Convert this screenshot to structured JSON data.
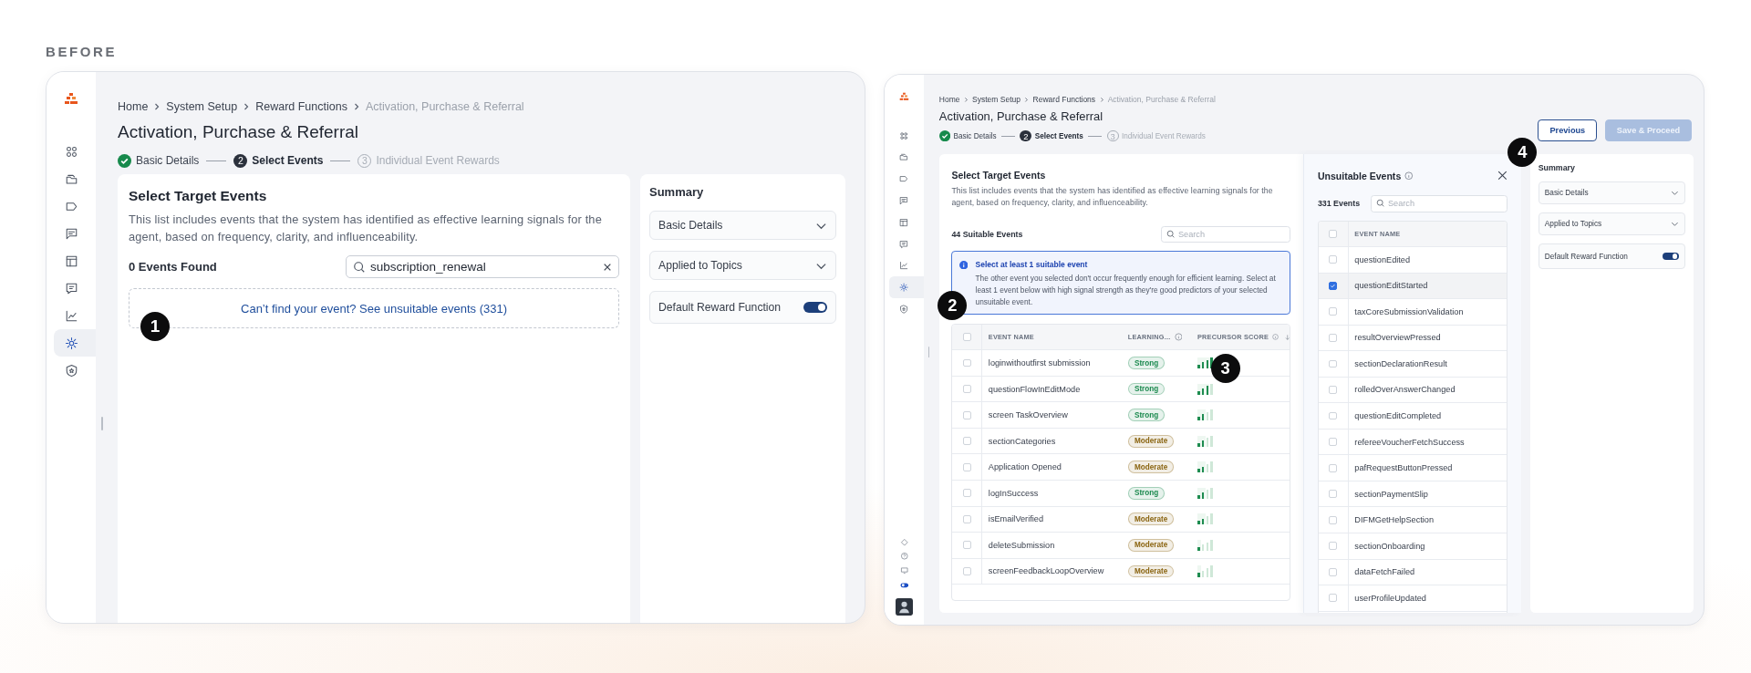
{
  "heading": "BEFORE",
  "screens": [
    {
      "sidebar": {
        "items": [
          {
            "selected": false
          },
          {
            "selected": false
          },
          {
            "selected": false
          },
          {
            "selected": false
          },
          {
            "selected": false
          },
          {
            "selected": false
          },
          {
            "selected": false
          },
          {
            "selected": true
          },
          {
            "selected": false
          }
        ]
      },
      "breadcrumb": [
        "Home",
        "System Setup",
        "Reward Functions",
        "Activation, Purchase & Referral"
      ],
      "title": "Activation, Purchase & Referral",
      "steps": [
        {
          "label": "Basic Details",
          "kind": "done"
        },
        {
          "number": "2",
          "label": "Select Events",
          "kind": "current"
        },
        {
          "number": "3",
          "label": "Individual Event Rewards",
          "kind": "upcoming"
        }
      ],
      "main": {
        "title": "Select Target Events",
        "description": "This list includes events that the system has identified as effective learning signals for the agent, based on frequency, clarity, and influenceability.",
        "count": "0 Events Found",
        "search": {
          "value": "subscription_renewal"
        },
        "empty_link": "Can’t find your event? See unsuitable events (331)"
      },
      "summary": {
        "title": "Summary",
        "items": [
          {
            "kind": "dropdown",
            "label": "Basic Details"
          },
          {
            "kind": "dropdown",
            "label": "Applied to Topics"
          },
          {
            "kind": "toggle",
            "label": "Default Reward Function",
            "on": true
          }
        ]
      },
      "markers": [
        "1"
      ]
    },
    {
      "sidebar": {
        "items": [
          {
            "selected": false
          },
          {
            "selected": false
          },
          {
            "selected": false
          },
          {
            "selected": false
          },
          {
            "selected": false
          },
          {
            "selected": false
          },
          {
            "selected": false
          },
          {
            "selected": true
          },
          {
            "selected": false
          }
        ],
        "utility_icons": true
      },
      "breadcrumb": [
        "Home",
        "System Setup",
        "Reward Functions",
        "Activation, Purchase & Referral"
      ],
      "title": "Activation, Purchase & Referral",
      "steps": [
        {
          "label": "Basic Details",
          "kind": "done"
        },
        {
          "number": "2",
          "label": "Select Events",
          "kind": "current"
        },
        {
          "number": "3",
          "label": "Individual Event Rewards",
          "kind": "upcoming"
        }
      ],
      "actions": [
        {
          "label": "Previous",
          "kind": "outline",
          "disabled": false
        },
        {
          "label": "Save & Proceed",
          "kind": "primary",
          "disabled": true
        }
      ],
      "main": {
        "title": "Select Target Events",
        "description": "This list includes events that the system has identified as effective learning signals for the agent, based on frequency, clarity, and influenceability.",
        "count": "44 Suitable Events",
        "search": {
          "placeholder": "Search"
        },
        "notice": {
          "title": "Select at least 1 suitable event",
          "text": "The other event you selected don't occur frequently enough for efficient learning. Select at least 1 event below with high signal strength as they're good predictors of your selected unsuitable event."
        },
        "table": {
          "select_all_checked": false,
          "columns": [
            "EVENT NAME",
            "LEARNING...",
            "PRECURSOR SCORE"
          ],
          "rows": [
            {
              "name": "loginwithoutfirst submission",
              "checked": false,
              "strength": "Strong",
              "color": "#1c8a4f",
              "level": 1
            },
            {
              "name": "questionFlowInEditMode",
              "checked": false,
              "strength": "Strong",
              "color": "#1c8a4f",
              "level": 0.75
            },
            {
              "name": "screen TaskOverview",
              "checked": false,
              "strength": "Strong",
              "color": "#1c8a4f",
              "level": 0.5
            },
            {
              "name": "sectionCategories",
              "checked": false,
              "strength": "Moderate",
              "color": "#8a6410",
              "level": 0.5
            },
            {
              "name": "Application Opened",
              "checked": false,
              "strength": "Moderate",
              "color": "#8a6410",
              "level": 0.5
            },
            {
              "name": "logInSuccess",
              "checked": false,
              "strength": "Strong",
              "color": "#1c8a4f",
              "level": 0.5
            },
            {
              "name": "isEmailVerified",
              "checked": false,
              "strength": "Moderate",
              "color": "#8a6410",
              "level": 0.5
            },
            {
              "name": "deleteSubmission",
              "checked": false,
              "strength": "Moderate",
              "color": "#8a6410",
              "level": 0.25
            },
            {
              "name": "screenFeedbackLoopOverview",
              "checked": false,
              "strength": "Moderate",
              "color": "#8a6410",
              "level": 0.25
            }
          ]
        }
      },
      "unsuitable": {
        "title": "Unsuitable Events",
        "count": "331 Events",
        "search": {
          "placeholder": "Search"
        },
        "select_all_checked": false,
        "column": "EVENT NAME",
        "rows": [
          {
            "name": "questionEdited",
            "checked": false
          },
          {
            "name": "questionEditStarted",
            "checked": true
          },
          {
            "name": "taxCoreSubmissionValidation",
            "checked": false
          },
          {
            "name": "resultOverviewPressed",
            "checked": false
          },
          {
            "name": "sectionDeclarationResult",
            "checked": false
          },
          {
            "name": "rolledOverAnswerChanged",
            "checked": false
          },
          {
            "name": "questionEditCompleted",
            "checked": false
          },
          {
            "name": "refereeVoucherFetchSuccess",
            "checked": false
          },
          {
            "name": "pafRequestButtonPressed",
            "checked": false
          },
          {
            "name": "sectionPaymentSlip",
            "checked": false
          },
          {
            "name": "DIFMGetHelpSection",
            "checked": false
          },
          {
            "name": "sectionOnboarding",
            "checked": false
          },
          {
            "name": "dataFetchFailed",
            "checked": false
          },
          {
            "name": "userProfileUpdated",
            "checked": false
          }
        ]
      },
      "summary": {
        "title": "Summary",
        "items": [
          {
            "kind": "dropdown",
            "label": "Basic Details"
          },
          {
            "kind": "dropdown",
            "label": "Applied to Topics"
          },
          {
            "kind": "toggle",
            "label": "Default Reward Function",
            "on": true
          }
        ]
      },
      "markers": [
        "2",
        "3",
        "4"
      ]
    }
  ]
}
